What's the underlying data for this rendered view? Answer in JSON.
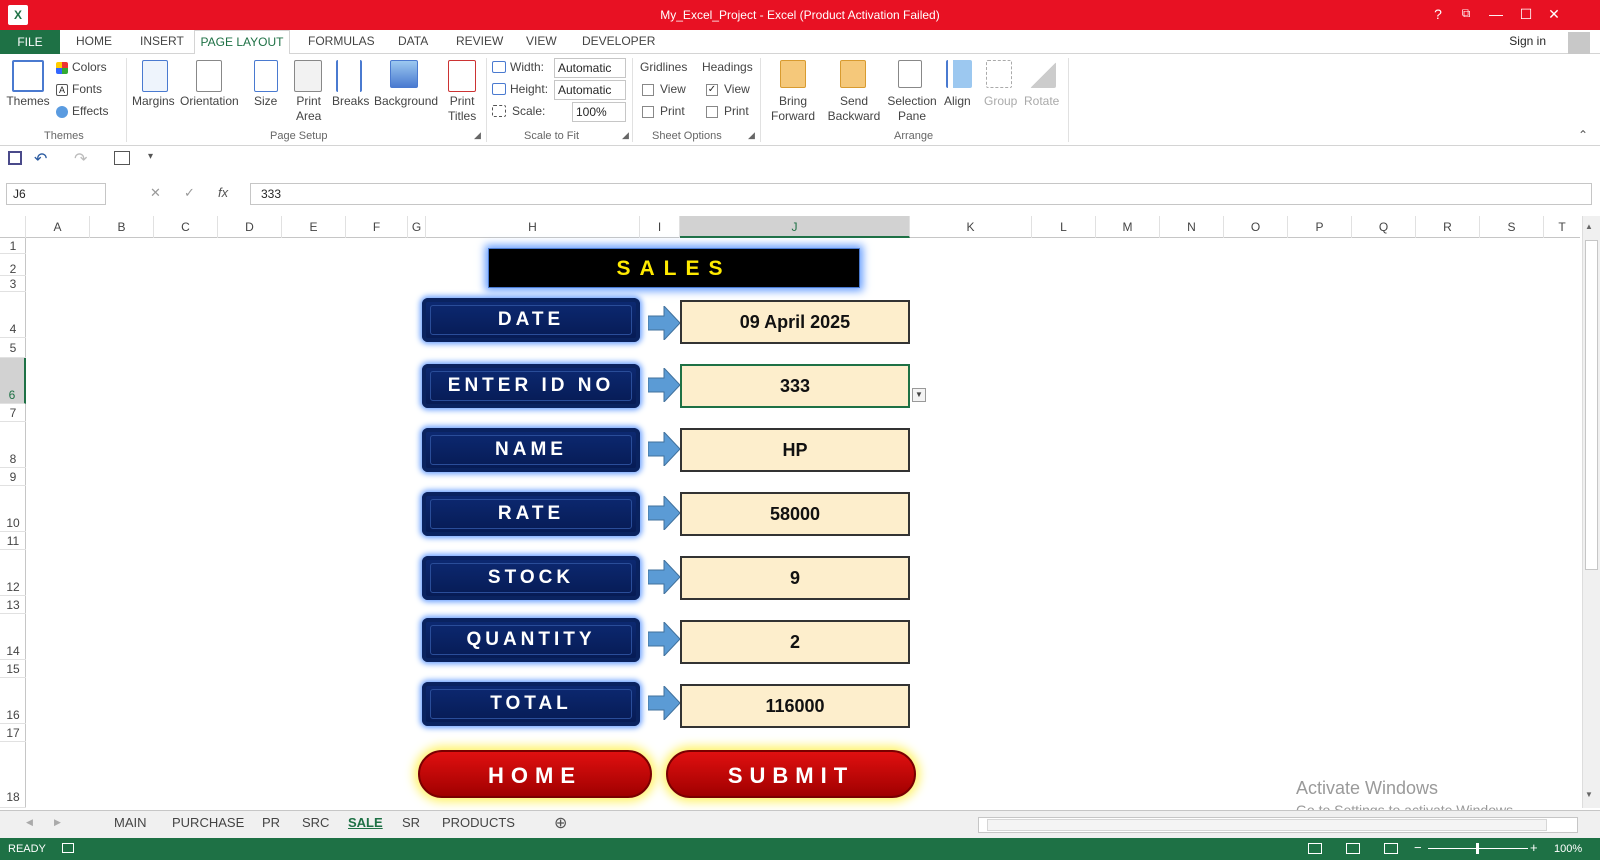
{
  "window": {
    "title": "My_Excel_Project -  Excel (Product Activation Failed)",
    "help": "?",
    "ribbon_display": "⧉",
    "minimize": "—",
    "restore": "☐",
    "close": "✕",
    "app_icon": "X",
    "title_color": "#e81123"
  },
  "tabs": {
    "file": "FILE",
    "items": [
      "HOME",
      "INSERT",
      "PAGE LAYOUT",
      "FORMULAS",
      "DATA",
      "REVIEW",
      "VIEW",
      "DEVELOPER"
    ],
    "active": "PAGE LAYOUT",
    "sign_in": "Sign in"
  },
  "ribbon": {
    "themes": {
      "themes": "Themes",
      "colors": "Colors",
      "fonts": "Fonts",
      "effects": "Effects",
      "group": "Themes"
    },
    "page_setup": {
      "margins": "Margins",
      "orientation": "Orientation",
      "size": "Size",
      "print_area_1": "Print",
      "print_area_2": "Area",
      "breaks": "Breaks",
      "background": "Background",
      "print_titles_1": "Print",
      "print_titles_2": "Titles",
      "group": "Page Setup"
    },
    "scale": {
      "width_label": "Width:",
      "width_value": "Automatic",
      "height_label": "Height:",
      "height_value": "Automatic",
      "scale_label": "Scale:",
      "scale_value": "100%",
      "group": "Scale to Fit"
    },
    "sheet_options": {
      "gridlines": "Gridlines",
      "headings": "Headings",
      "view": "View",
      "print": "Print",
      "group": "Sheet Options",
      "gridlines_view": false,
      "headings_view": true
    },
    "arrange": {
      "bring_1": "Bring",
      "bring_2": "Forward",
      "send_1": "Send",
      "send_2": "Backward",
      "selection_1": "Selection",
      "selection_2": "Pane",
      "align": "Align",
      "group_btn": "Group",
      "rotate": "Rotate",
      "group": "Arrange"
    }
  },
  "formula_bar": {
    "name_box": "J6",
    "cancel": "✕",
    "enter": "✓",
    "fx": "fx",
    "value": "333"
  },
  "columns": [
    "A",
    "B",
    "C",
    "D",
    "E",
    "F",
    "G",
    "H",
    "I",
    "J",
    "K",
    "L",
    "M",
    "N",
    "O",
    "P",
    "Q",
    "R",
    "S",
    "T"
  ],
  "selected_column": "J",
  "rows": [
    "1",
    "2",
    "3",
    "4",
    "5",
    "6",
    "7",
    "8",
    "9",
    "10",
    "11",
    "12",
    "13",
    "14",
    "15",
    "16",
    "17",
    "18"
  ],
  "selected_row": "6",
  "form": {
    "title": "SALES",
    "fields": [
      {
        "label": "DATE",
        "value": "09 April 2025"
      },
      {
        "label": "ENTER ID NO",
        "value": "333"
      },
      {
        "label": "NAME",
        "value": "HP"
      },
      {
        "label": "RATE",
        "value": "58000"
      },
      {
        "label": "STOCK",
        "value": "9"
      },
      {
        "label": "QUANTITY",
        "value": "2"
      },
      {
        "label": "TOTAL",
        "value": "116000"
      }
    ],
    "home_button": "HOME",
    "submit_button": "SUBMIT"
  },
  "sheets": {
    "items": [
      "MAIN",
      "PURCHASE",
      "PR",
      "SRC",
      "SALE",
      "SR",
      "PRODUCTS"
    ],
    "active": "SALE",
    "add": "⊕"
  },
  "status": {
    "ready": "READY",
    "zoom": "100%"
  },
  "watermark": {
    "line1": "Activate Windows",
    "line2": "Go to Settings to activate Windows."
  },
  "colors": {
    "excel_green": "#1e7145",
    "label_button": "#0d2a74",
    "value_box": "#fdeecc",
    "red_button": "#e01010",
    "title_text": "#ffea00"
  }
}
